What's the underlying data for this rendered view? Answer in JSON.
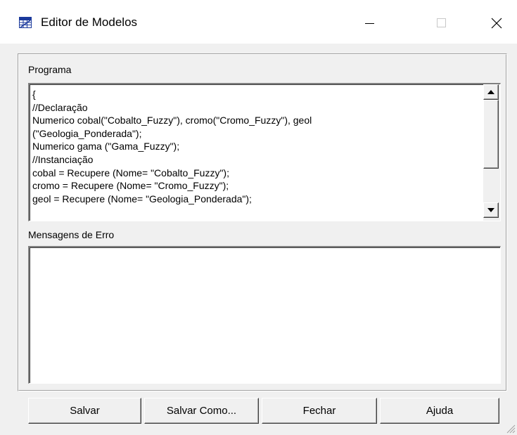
{
  "window": {
    "title": "Editor de Modelos",
    "icon": "grid-app-icon",
    "controls": [
      "minimize-icon",
      "maximize-icon",
      "close-icon"
    ]
  },
  "program": {
    "label": "Programa",
    "lines": [
      "{",
      "//Declaração",
      "Numerico cobal(\"Cobalto_Fuzzy\"), cromo(\"Cromo_Fuzzy\"), geol",
      "(\"Geologia_Ponderada\");",
      "Numerico gama (\"Gama_Fuzzy\");",
      "//Instanciação",
      "cobal = Recupere (Nome= \"Cobalto_Fuzzy\");",
      "cromo = Recupere (Nome= \"Cromo_Fuzzy\");",
      "geol = Recupere (Nome= \"Geologia_Ponderada\");"
    ]
  },
  "errors": {
    "label": "Mensagens de Erro",
    "text": ""
  },
  "buttons": {
    "save": "Salvar",
    "save_as": "Salvar Como...",
    "close": "Fechar",
    "help": "Ajuda"
  },
  "colors": {
    "window_bg": "#f0f0f0",
    "titlebar_bg": "#ffffff",
    "icon_blue": "#1b3a9c"
  }
}
